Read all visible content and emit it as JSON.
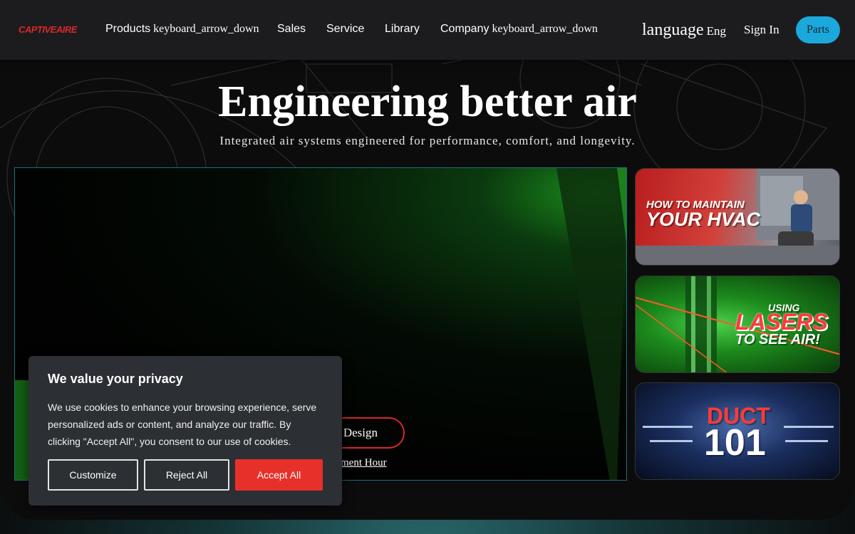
{
  "nav": {
    "logo": "CAPTIVEAIRE",
    "items": [
      {
        "label": "Products",
        "arrow": "keyboard_arrow_down"
      },
      {
        "label": "Sales"
      },
      {
        "label": "Service"
      },
      {
        "label": "Library"
      },
      {
        "label": "Company",
        "arrow": "keyboard_arrow_down"
      }
    ],
    "language_icon": "language",
    "language_label": "Eng",
    "sign_in": "Sign In",
    "parts_button": "Parts"
  },
  "hero": {
    "title": "Engineering better air",
    "subtitle": "Integrated air systems engineered for performance, comfort, and longevity.",
    "design_button": "Design",
    "link_partial": "ment Hour"
  },
  "thumbnails": [
    {
      "line1": "HOW TO MAINTAIN",
      "line2": "YOUR HVAC"
    },
    {
      "line1": "USING",
      "line2": "LASERS",
      "line3": "TO SEE AIR!"
    },
    {
      "line1": "DUCT",
      "line2": "101"
    }
  ],
  "cookie": {
    "title": "We value your privacy",
    "text": "We use cookies to enhance your browsing experience, serve personalized ads or content, and analyze our traffic. By clicking \"Accept All\", you consent to our use of cookies.",
    "customize": "Customize",
    "reject": "Reject All",
    "accept": "Accept All"
  },
  "colors": {
    "brand_red": "#d8282a",
    "accent_blue": "#1ba9dc",
    "accept_red": "#e8302a"
  }
}
